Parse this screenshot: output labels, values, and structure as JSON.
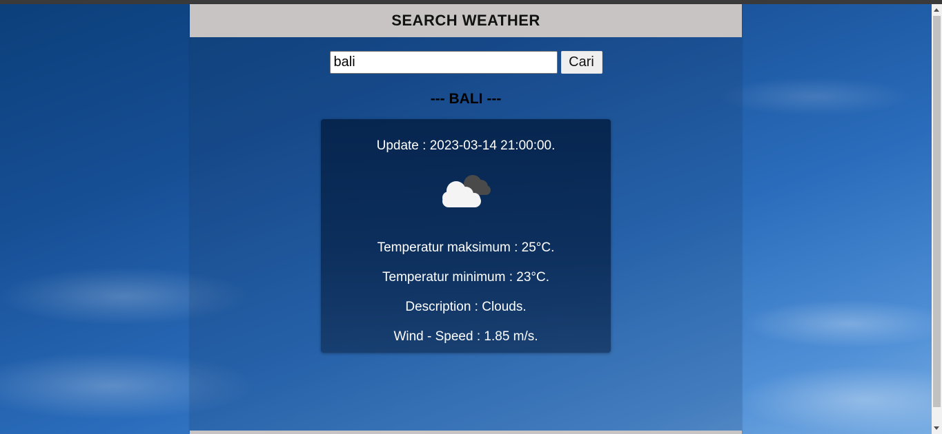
{
  "header": {
    "title": "SEARCH WEATHER"
  },
  "search": {
    "value": "bali",
    "button_label": "Cari"
  },
  "result": {
    "city_heading": "--- BALI ---",
    "update": "Update : 2023-03-14 21:00:00.",
    "icon": "clouds-icon",
    "temp_max": "Temperatur maksimum : 25°C.",
    "temp_min": "Temperatur minimum : 23°C.",
    "description": "Description : Clouds.",
    "wind_speed": "Wind - Speed : 1.85 m/s."
  },
  "colors": {
    "header_bg": "#c8c4c4",
    "card_bg": "#0a2a55",
    "text_light": "#ffffff"
  }
}
